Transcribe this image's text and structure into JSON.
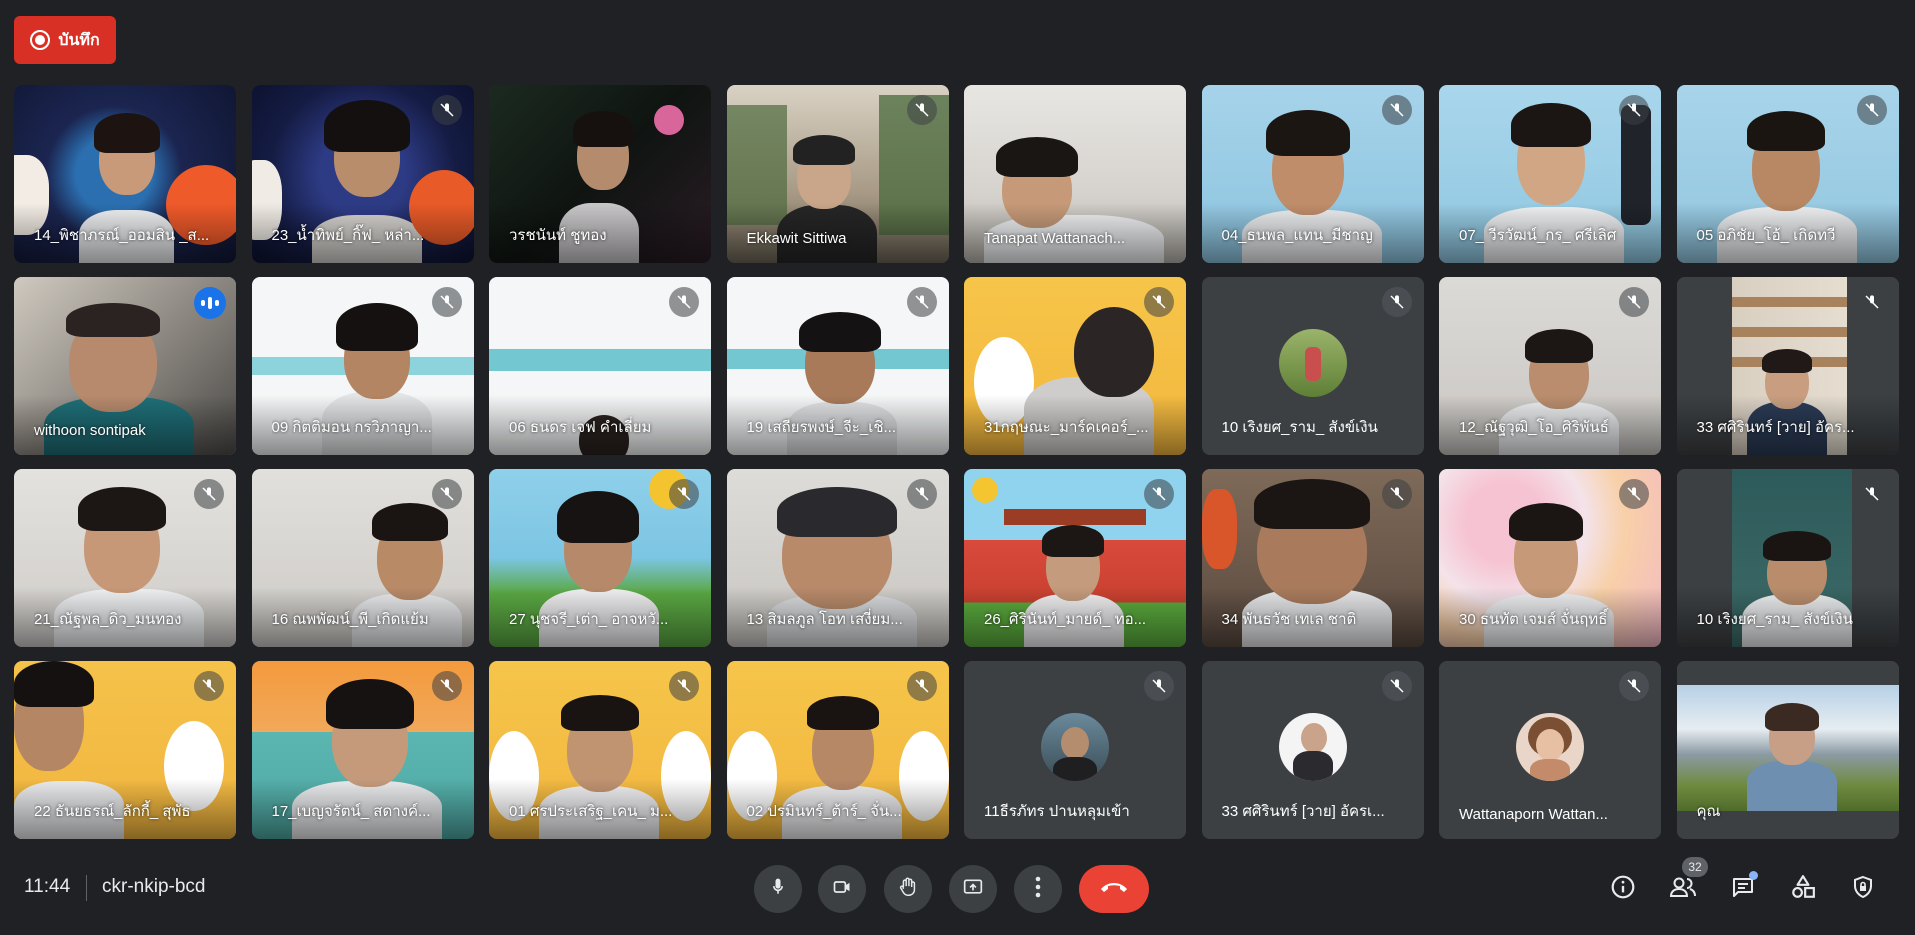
{
  "record_button": {
    "label": "บันทึก"
  },
  "tiles": [
    {
      "name": "14_พิชาภรณ์_ออมสิน _ส..."
    },
    {
      "name": "23_น้ำทิพย์_กิ๊ฟ_ หล่า..."
    },
    {
      "name": "วรชนันท์ ชูทอง"
    },
    {
      "name": "Ekkawit Sittiwa"
    },
    {
      "name": "Tanapat Wattanach..."
    },
    {
      "name": "04_ธนพล_แทน_มีชาญ"
    },
    {
      "name": "07_ วีรวัฒน์_กร_ ศรีเลิศ"
    },
    {
      "name": "05 อภิชัย_โอ้_ เกิดทวี"
    },
    {
      "name": "withoon sontipak"
    },
    {
      "name": "09 กิตติมอน กรวิภาญา..."
    },
    {
      "name": "06 ธนดร เจฟ คำเลี่ยม"
    },
    {
      "name": "19 เสถียรพงษ์_จีะ_เชิ..."
    },
    {
      "name": "31กฤษณะ_มาร์คเคอร์_..."
    },
    {
      "name": "10 เริงยศ_ราม_ สังข์เงิน"
    },
    {
      "name": "12_ณัฐวุฒิ_โอ_ศิริพันธ์"
    },
    {
      "name": "33 ศศิรินทร์ [วาย] อัคร..."
    },
    {
      "name": "21_ณัฐพล_ดิว_มนทอง"
    },
    {
      "name": "16 ณพพัฒน์_พี_เกิดแย้ม"
    },
    {
      "name": "27 นุชจรี_เต่า_ อาจหวั..."
    },
    {
      "name": "13 สิมลภูล โอท เสงี่ยม..."
    },
    {
      "name": "26_ศิรินันท์_มายด์_ ทอ..."
    },
    {
      "name": "34 พันธวัช เทเล ชาติ"
    },
    {
      "name": "30 ธนทัต เจมส์ จั่นฤทธิ์"
    },
    {
      "name": "10 เริงยศ_ราม_ สังข์เงิน"
    },
    {
      "name": "22 ธันยธรณ์_ลักกี้_ สุพัธ"
    },
    {
      "name": "17_เบญจรัตน์_ สดางค์..."
    },
    {
      "name": "01 ศรประเสริฐ_เคน_ ม..."
    },
    {
      "name": "02 ปรมินทร์_ต้าร์_ จั่น..."
    },
    {
      "name": "11ธีรภัทร ปานหลุมเข้า"
    },
    {
      "name": "33 ศศิรินทร์ [วาย] อัครเ..."
    },
    {
      "name": "Wattanaporn Wattan..."
    },
    {
      "name": "คุณ"
    }
  ],
  "bottom_bar": {
    "time": "11:44",
    "meeting_code": "ckr-nkip-bcd",
    "participants_count": "32"
  },
  "colors": {
    "background": "#202124",
    "record": "#d93025",
    "hangup": "#ea4335",
    "speaking": "#8ab4f8"
  }
}
